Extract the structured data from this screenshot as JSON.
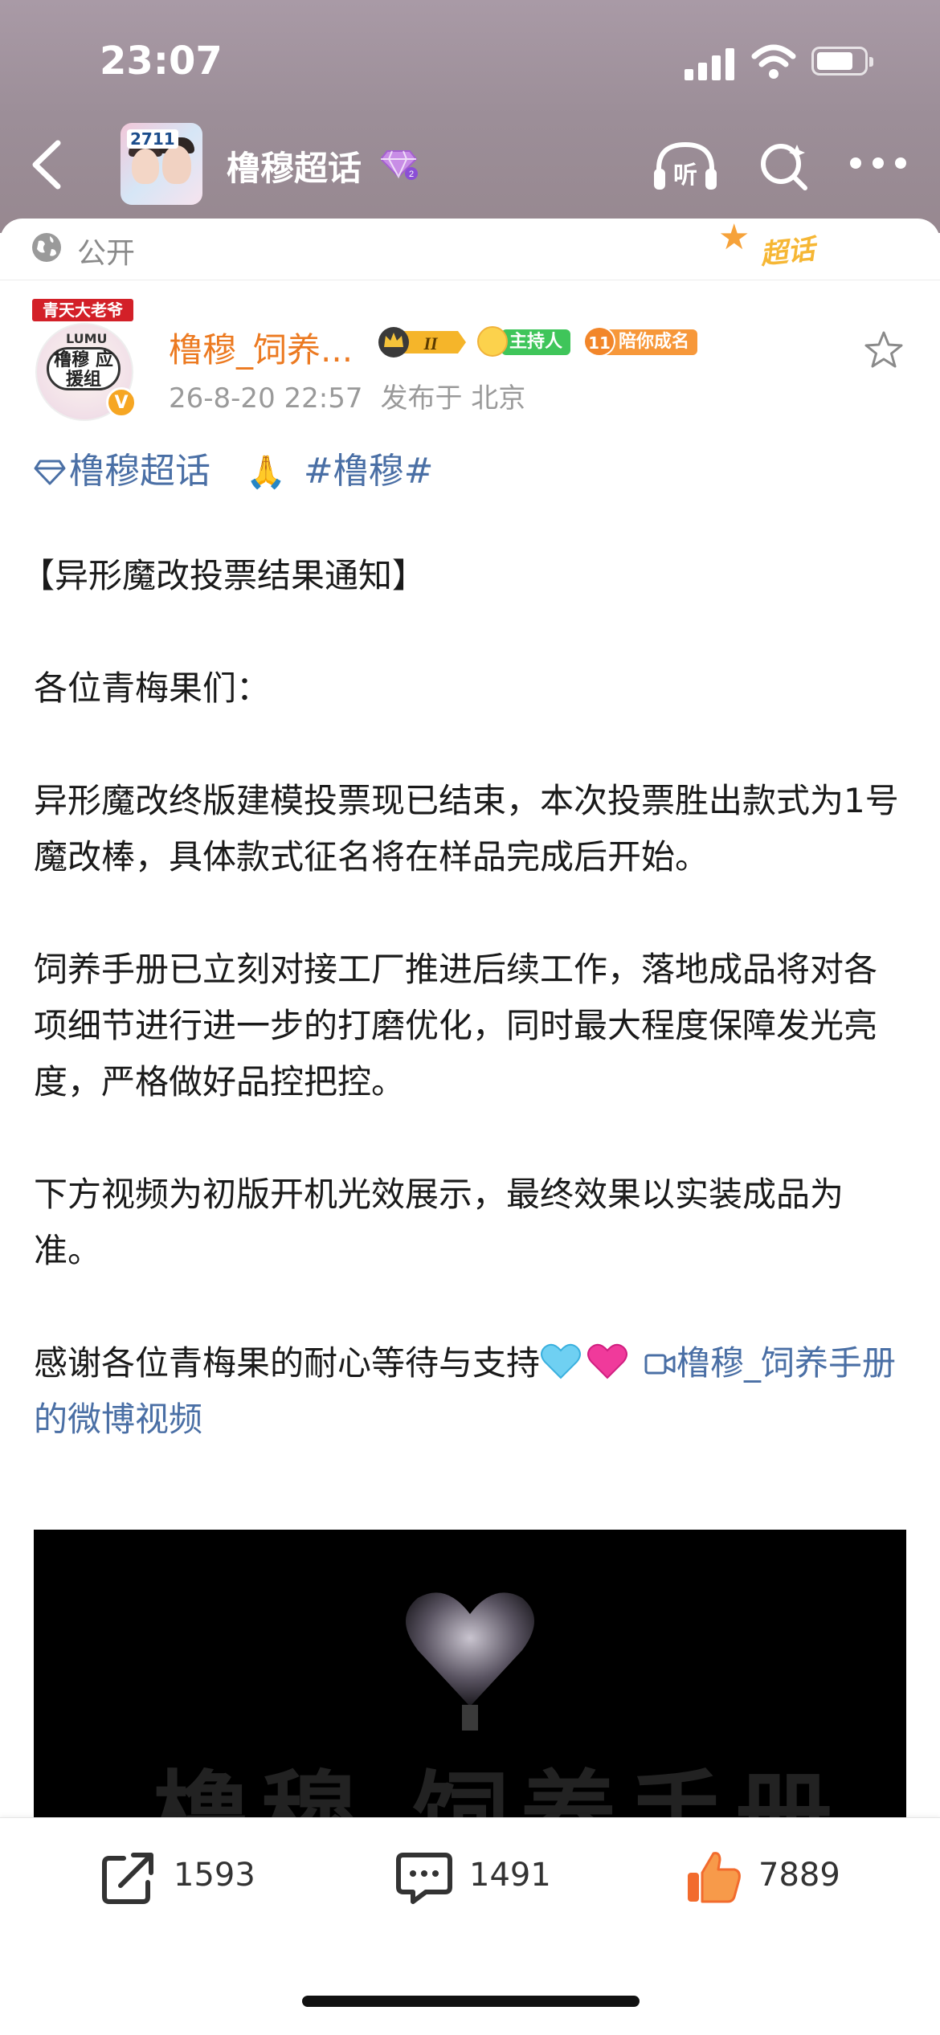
{
  "status_bar": {
    "time": "23:07"
  },
  "nav": {
    "title": "橹穆超话",
    "cover_badge": "2711",
    "icons": [
      "back-icon",
      "listen-icon",
      "search-icon",
      "more-icon"
    ]
  },
  "visibility": {
    "label": "公开",
    "supertopic_tag": "超话"
  },
  "post": {
    "avatar": {
      "banner": "青天大老爷",
      "caption": "LUMU",
      "sign_text": "橹穆 应援组",
      "badge": "V"
    },
    "author": "橹穆_饲养...",
    "badges": {
      "crown_level": "II",
      "host": "主持人",
      "medal_level": "11",
      "medal_label": "陪你成名"
    },
    "timestamp": "26-8-20 22:57",
    "location": "发布于 北京",
    "topic_links": {
      "supertopic": "橹穆超话",
      "emoji": "🙏",
      "hashtag": "#橹穆#"
    },
    "paragraphs": {
      "title": "【异形魔改投票结果通知】",
      "greeting": "各位青梅果们：",
      "p1": "异形魔改终版建模投票现已结束，本次投票胜出款式为1号魔改棒，具体款式征名将在样品完成后开始。",
      "p2": "饲养手册已立刻对接工厂推进后续工作，落地成品将对各项细节进行进一步的打磨优化，同时最大程度保障发光亮度，严格做好品控把控。",
      "p3": "下方视频为初版开机光效展示，最终效果以实装成品为准。",
      "p4_text": "感谢各位青梅果的耐心等待与支持",
      "p4_link": "橹穆_饲养手册的微博视频"
    },
    "video": {
      "watermark": "橹穆  饲养手册"
    }
  },
  "actions": {
    "repost_count": "1593",
    "comment_count": "1491",
    "like_count": "7889"
  },
  "colors": {
    "link": "#4a6fa5",
    "author": "#ec7a21",
    "like": "#f26b2d",
    "header_bg": "#9c8e98"
  }
}
